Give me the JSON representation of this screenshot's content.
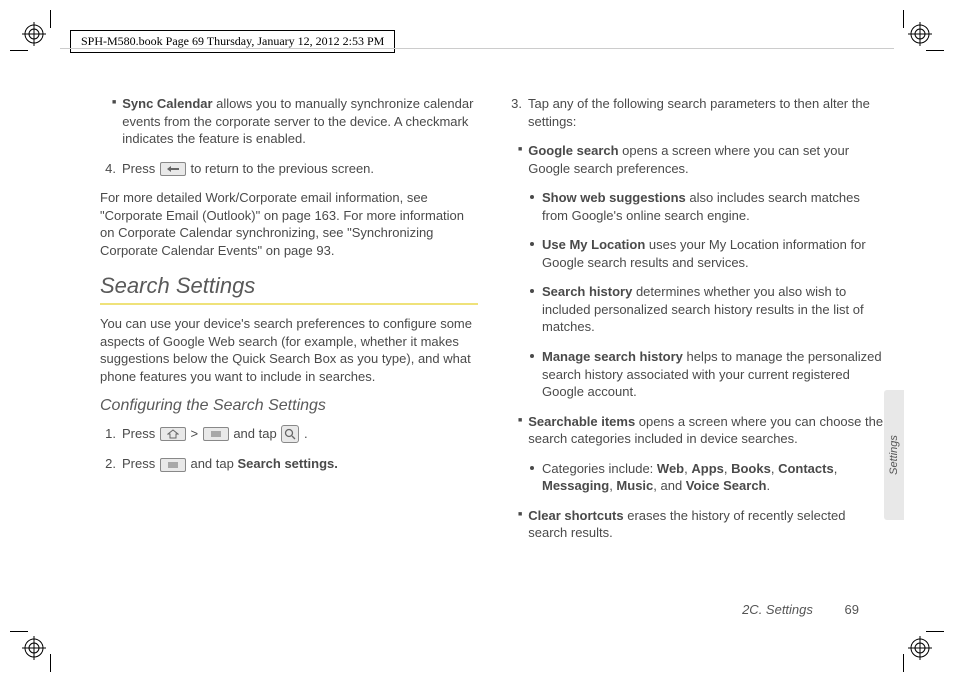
{
  "header": {
    "meta_line": "SPH-M580.book  Page 69  Thursday, January 12, 2012  2:53 PM"
  },
  "left_col": {
    "sync_label": "Sync Calendar",
    "sync_text": " allows you to manually synchronize calendar events from the corporate server to the device. A checkmark indicates the feature is enabled.",
    "step4_num": "4.",
    "step4_a": "Press ",
    "step4_b": " to return to the previous screen.",
    "detail_para": "For more detailed Work/Corporate email information, see \"Corporate Email (Outlook)\" on page 163. For more information on Corporate Calendar synchronizing, see \"Synchronizing Corporate Calendar Events\" on page 93.",
    "h1": "Search Settings",
    "intro": "You can use your device's search preferences to configure some aspects of Google Web search (for example, whether it makes suggestions below the Quick Search Box as you type), and what phone features you want to include in searches.",
    "h2": "Configuring the Search Settings",
    "s1_num": "1.",
    "s1_a": "Press ",
    "s1_gt": " > ",
    "s1_b": " and tap ",
    "s1_dot": " .",
    "s2_num": "2.",
    "s2_a": "Press ",
    "s2_b": " and tap ",
    "s2_c": "Search settings."
  },
  "right_col": {
    "s3_num": "3.",
    "s3_text": "Tap any of the following search parameters to then alter the settings:",
    "google_label": "Google search",
    "google_text": " opens a screen where you can set your Google search preferences.",
    "show_label": "Show web suggestions",
    "show_text": " also includes search matches from Google's online search engine.",
    "loc_label": "Use My Location",
    "loc_text": " uses your My Location information for Google search results and services.",
    "hist_label": "Search history",
    "hist_text": " determines whether you also wish to included personalized search history results in the list of matches.",
    "manage_label": "Manage search history",
    "manage_text": " helps to manage the personalized search history associated with your current registered Google account.",
    "searchable_label": "Searchable items",
    "searchable_text": " opens a screen where you can choose the search categories included in device searches.",
    "cat_a": "Categories include: ",
    "cat_web": "Web",
    "cat_apps": "Apps",
    "cat_books": "Books",
    "cat_contacts": "Contacts",
    "cat_msg": "Messaging",
    "cat_music": "Music",
    "cat_and": ", and ",
    "cat_voice": "Voice Search",
    "cat_dot": ".",
    "clear_label": "Clear shortcuts",
    "clear_text": " erases the history of recently selected search results."
  },
  "side_tab": "Settings",
  "footer": {
    "section": "2C. Settings",
    "page": "69"
  }
}
